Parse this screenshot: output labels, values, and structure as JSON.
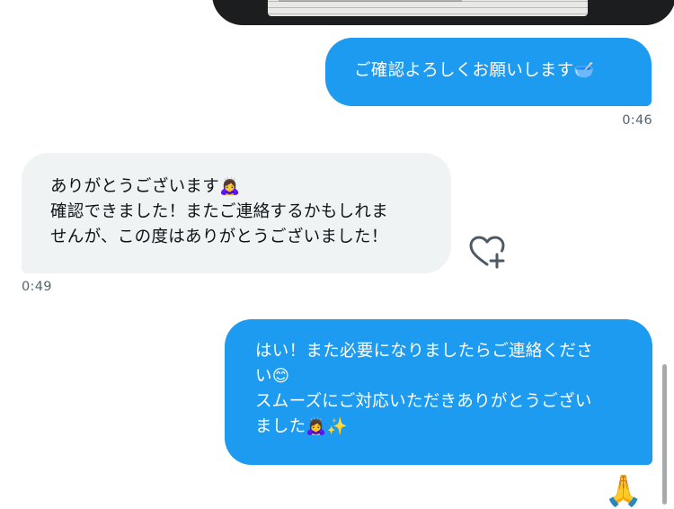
{
  "messages": [
    {
      "direction": "outgoing",
      "text": "ご確認よろしくお願いします🥣",
      "time": "0:46"
    },
    {
      "direction": "incoming",
      "text": "ありがとうございます🙇‍♀️\n確認できました！またご連絡するかもしれま\nせんが、この度はありがとうございました！",
      "time": "0:49"
    },
    {
      "direction": "outgoing",
      "text": "はい！また必要になりましたらご連絡くださ\nい😊\nスムーズにご対応いただきありがとうござい\nました🙇‍♀️✨"
    }
  ],
  "icons": {
    "react_button": "heart-plus-icon",
    "reaction": "🙏"
  },
  "colors": {
    "outgoing_bubble": "#1d9bf0",
    "incoming_bubble": "#eff3f4",
    "timestamp": "#536471"
  }
}
